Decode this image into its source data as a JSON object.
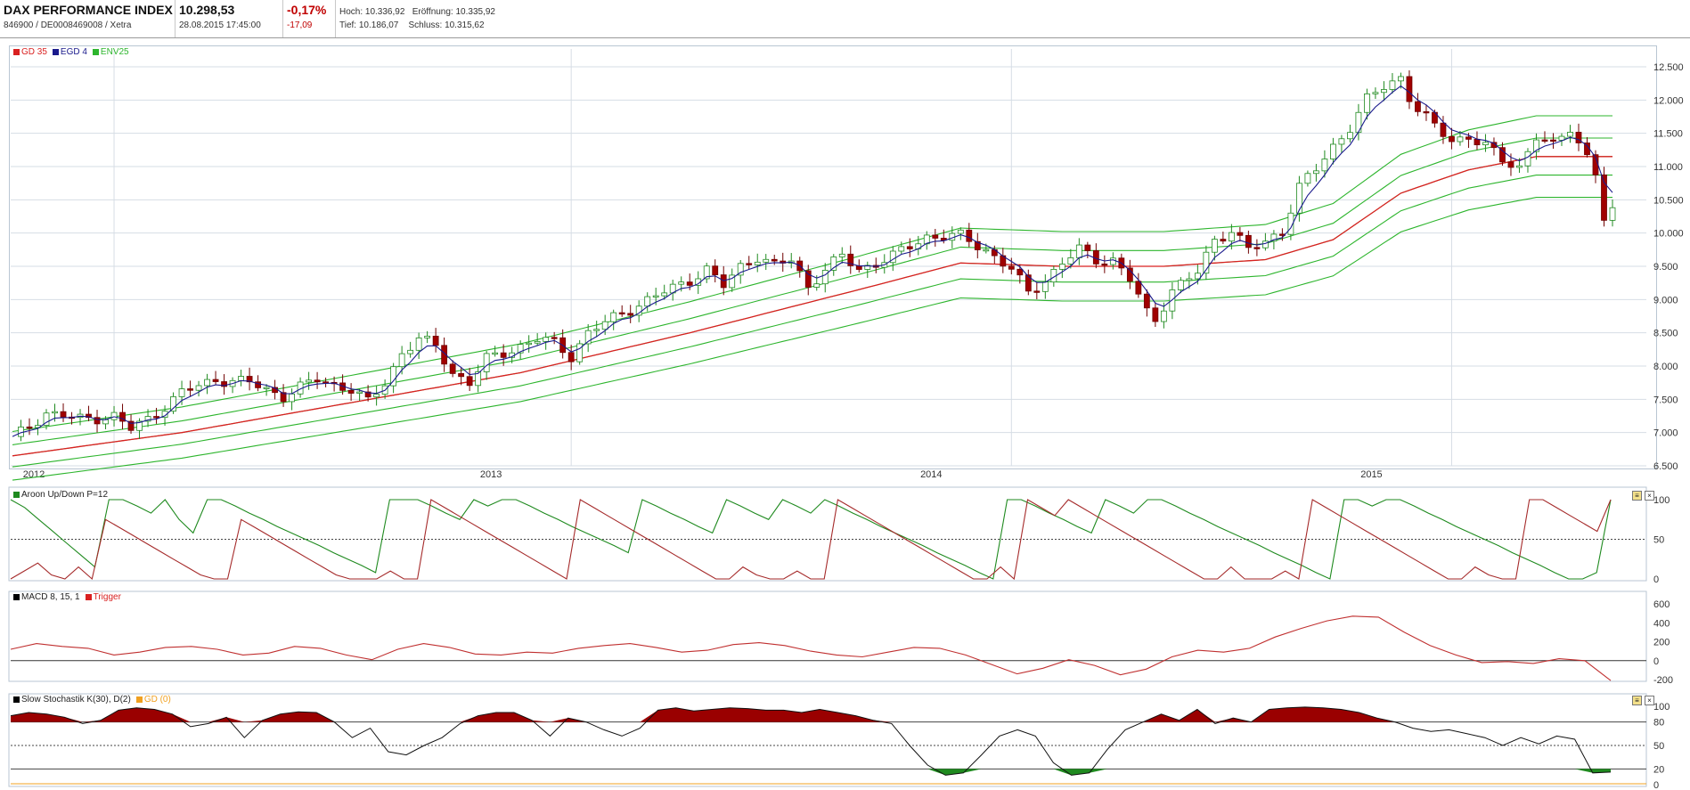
{
  "header": {
    "name": "DAX PERFORMANCE INDEX",
    "wkn_isin": "846900 / DE0008469008 / Xetra",
    "price": "10.298,53",
    "datetime": "28.08.2015 17:45:00",
    "change_pct": "-0,17%",
    "change_abs": "-17,09",
    "high_label": "Hoch:",
    "high": "10.336,92",
    "open_label": "Eröffnung:",
    "open": "10.335,92",
    "low_label": "Tief:",
    "low": "10.186,07",
    "close_label": "Schluss:",
    "close": "10.315,62"
  },
  "colors": {
    "up_candle_fill": "#ffffff",
    "up_candle_border": "#1f8a1f",
    "down_candle_fill": "#a00000",
    "gd35": "#d92020",
    "egd4": "#1a1a8c",
    "env25": "#2db52d",
    "aroon_up": "#1f8a1f",
    "aroon_down": "#a52a2a",
    "macd": "#000000",
    "trigger": "#c03030",
    "stoch_fill_high": "#9a0000",
    "stoch_fill_low": "#1f8a1f",
    "gd_orange": "#f0a020",
    "grid": "#d6dde5"
  },
  "chart_data": [
    {
      "type": "candlestick",
      "legend": [
        "GD 35",
        "EGD 4",
        "ENV25"
      ],
      "x_ticks": [
        "2012",
        "2013",
        "2014",
        "2015"
      ],
      "x_tick_week": [
        0,
        52,
        104,
        156
      ],
      "weeks": 190,
      "ylim": [
        6500,
        12500
      ],
      "y_ticks": [
        "12.500",
        "12.000",
        "11.500",
        "11.000",
        "10.500",
        "10.000",
        "9.500",
        "9.000",
        "8.500",
        "8.000",
        "7.500",
        "7.000",
        "6.500"
      ],
      "y_tick_values": [
        12500,
        12000,
        11500,
        11000,
        10500,
        10000,
        9500,
        9000,
        8500,
        8000,
        7500,
        7000,
        6500
      ],
      "close_points": [
        [
          0,
          6900
        ],
        [
          4,
          7300
        ],
        [
          8,
          7200
        ],
        [
          12,
          7250
        ],
        [
          14,
          7050
        ],
        [
          16,
          7200
        ],
        [
          20,
          7600
        ],
        [
          24,
          7800
        ],
        [
          28,
          7750
        ],
        [
          32,
          7550
        ],
        [
          36,
          7800
        ],
        [
          40,
          7650
        ],
        [
          42,
          7450
        ],
        [
          44,
          7750
        ],
        [
          46,
          8200
        ],
        [
          48,
          8400
        ],
        [
          50,
          8300
        ],
        [
          52,
          7900
        ],
        [
          54,
          7750
        ],
        [
          56,
          8100
        ],
        [
          60,
          8300
        ],
        [
          62,
          8400
        ],
        [
          64,
          8350
        ],
        [
          66,
          8150
        ],
        [
          68,
          8500
        ],
        [
          70,
          8650
        ],
        [
          72,
          8800
        ],
        [
          76,
          9050
        ],
        [
          80,
          9300
        ],
        [
          82,
          9450
        ],
        [
          84,
          9200
        ],
        [
          86,
          9500
        ],
        [
          88,
          9650
        ],
        [
          90,
          9500
        ],
        [
          92,
          9600
        ],
        [
          94,
          9200
        ],
        [
          96,
          9450
        ],
        [
          98,
          9650
        ],
        [
          100,
          9450
        ],
        [
          102,
          9550
        ],
        [
          104,
          9650
        ],
        [
          108,
          9950
        ],
        [
          112,
          9950
        ],
        [
          115,
          9750
        ],
        [
          118,
          9450
        ],
        [
          120,
          9100
        ],
        [
          122,
          9300
        ],
        [
          124,
          9550
        ],
        [
          126,
          9750
        ],
        [
          128,
          9600
        ],
        [
          130,
          9600
        ],
        [
          132,
          9300
        ],
        [
          134,
          8800
        ],
        [
          135,
          8700
        ],
        [
          137,
          9150
        ],
        [
          140,
          9400
        ],
        [
          142,
          9900
        ],
        [
          144,
          10050
        ],
        [
          146,
          9750
        ],
        [
          148,
          9850
        ],
        [
          150,
          10050
        ],
        [
          152,
          10700
        ],
        [
          154,
          10950
        ],
        [
          156,
          11300
        ],
        [
          158,
          11600
        ],
        [
          160,
          12000
        ],
        [
          162,
          12200
        ],
        [
          164,
          12350
        ],
        [
          165,
          12050
        ],
        [
          166,
          11850
        ],
        [
          168,
          11600
        ],
        [
          170,
          11400
        ],
        [
          172,
          11450
        ],
        [
          174,
          11300
        ],
        [
          176,
          11100
        ],
        [
          178,
          11000
        ],
        [
          180,
          11450
        ],
        [
          182,
          11300
        ],
        [
          184,
          11600
        ],
        [
          186,
          11150
        ],
        [
          187,
          10900
        ],
        [
          188,
          10200
        ],
        [
          189,
          10300
        ]
      ],
      "gd35_points": [
        [
          0,
          6650
        ],
        [
          20,
          7000
        ],
        [
          40,
          7450
        ],
        [
          60,
          7900
        ],
        [
          80,
          8500
        ],
        [
          100,
          9150
        ],
        [
          112,
          9550
        ],
        [
          124,
          9500
        ],
        [
          136,
          9500
        ],
        [
          148,
          9600
        ],
        [
          156,
          9900
        ],
        [
          164,
          10600
        ],
        [
          172,
          10950
        ],
        [
          180,
          11150
        ],
        [
          189,
          11150
        ]
      ],
      "env_offset_pct": [
        2.5,
        5.5
      ]
    },
    {
      "type": "line",
      "title": "Aroon Up/Down P=12",
      "ylim": [
        0,
        100
      ],
      "y_ticks": [
        "100",
        "50",
        "0"
      ],
      "y_tick_values": [
        100,
        50,
        0
      ],
      "series": [
        {
          "name": "Aroon Up",
          "values": [
            100,
            90,
            75,
            60,
            45,
            30,
            15,
            100,
            100,
            92,
            83,
            100,
            75,
            58,
            100,
            100,
            92,
            83,
            75,
            66,
            58,
            50,
            42,
            33,
            25,
            17,
            8,
            100,
            100,
            100,
            92,
            83,
            75,
            100,
            92,
            100,
            100,
            92,
            83,
            75,
            66,
            58,
            50,
            42,
            33,
            100,
            92,
            83,
            75,
            66,
            58,
            100,
            92,
            83,
            75,
            100,
            92,
            83,
            100,
            92,
            83,
            75,
            66,
            58,
            50,
            42,
            33,
            25,
            17,
            8,
            0,
            100,
            100,
            92,
            83,
            75,
            66,
            58,
            100,
            92,
            83,
            100,
            100,
            92,
            83,
            75,
            66,
            58,
            50,
            42,
            33,
            25,
            17,
            8,
            0,
            100,
            100,
            92,
            100,
            100,
            92,
            83,
            75,
            66,
            58,
            50,
            42,
            33,
            25,
            17,
            8,
            0,
            0,
            8,
            100
          ]
        },
        {
          "name": "Aroon Down",
          "values": [
            0,
            10,
            20,
            5,
            0,
            15,
            0,
            75,
            65,
            55,
            45,
            35,
            25,
            15,
            5,
            0,
            0,
            75,
            65,
            55,
            45,
            35,
            25,
            15,
            5,
            0,
            0,
            0,
            10,
            0,
            0,
            100,
            90,
            80,
            70,
            60,
            50,
            40,
            30,
            20,
            10,
            0,
            100,
            90,
            80,
            70,
            60,
            50,
            40,
            30,
            20,
            10,
            0,
            0,
            15,
            5,
            0,
            0,
            10,
            0,
            0,
            100,
            90,
            80,
            70,
            60,
            50,
            40,
            30,
            20,
            10,
            0,
            0,
            15,
            0,
            100,
            90,
            80,
            100,
            90,
            80,
            70,
            60,
            50,
            40,
            30,
            20,
            10,
            0,
            0,
            15,
            0,
            0,
            0,
            10,
            0,
            100,
            90,
            80,
            70,
            60,
            50,
            40,
            30,
            20,
            10,
            0,
            0,
            15,
            5,
            0,
            0,
            100,
            100,
            90,
            80,
            70,
            60,
            100
          ]
        }
      ]
    },
    {
      "type": "line",
      "title": "MACD 8, 15, 1",
      "legend": [
        "MACD 8, 15, 1",
        "Trigger"
      ],
      "ylim": [
        -200,
        600
      ],
      "y_ticks": [
        "600",
        "400",
        "200",
        "0",
        "-200"
      ],
      "y_tick_values": [
        600,
        400,
        200,
        0,
        -200
      ],
      "series": [
        {
          "name": "Trigger",
          "values": [
            120,
            180,
            150,
            130,
            60,
            90,
            140,
            150,
            120,
            60,
            80,
            150,
            130,
            60,
            10,
            120,
            180,
            140,
            70,
            60,
            90,
            80,
            130,
            160,
            180,
            140,
            90,
            110,
            170,
            190,
            160,
            100,
            60,
            40,
            90,
            140,
            130,
            60,
            -40,
            -140,
            -80,
            10,
            -50,
            -150,
            -90,
            40,
            110,
            90,
            130,
            250,
            340,
            420,
            470,
            460,
            300,
            160,
            60,
            -20,
            -10,
            -30,
            20,
            0,
            -210
          ]
        }
      ]
    },
    {
      "type": "area",
      "title": "Slow Stochastik K(30), D(2)",
      "legend": [
        "Slow Stochastik K(30), D(2)",
        "GD (0)"
      ],
      "ylim": [
        0,
        100
      ],
      "y_ticks": [
        "100",
        "80",
        "50",
        "20",
        "0"
      ],
      "y_tick_values": [
        100,
        80,
        50,
        20,
        0
      ],
      "series": [
        {
          "name": "Slow Stochastik K(30), D(2)",
          "values": [
            88,
            92,
            90,
            86,
            78,
            82,
            95,
            98,
            96,
            90,
            74,
            78,
            86,
            60,
            82,
            90,
            93,
            92,
            80,
            60,
            72,
            42,
            38,
            50,
            60,
            78,
            88,
            92,
            92,
            82,
            62,
            85,
            80,
            70,
            62,
            72,
            95,
            98,
            94,
            96,
            98,
            97,
            95,
            95,
            92,
            96,
            92,
            88,
            82,
            78,
            50,
            25,
            12,
            15,
            38,
            62,
            70,
            62,
            28,
            12,
            15,
            45,
            70,
            80,
            90,
            82,
            96,
            78,
            85,
            80,
            96,
            98,
            99,
            98,
            96,
            92,
            85,
            80,
            72,
            68,
            70,
            65,
            60,
            50,
            60,
            52,
            62,
            58,
            15,
            16
          ]
        }
      ]
    }
  ]
}
